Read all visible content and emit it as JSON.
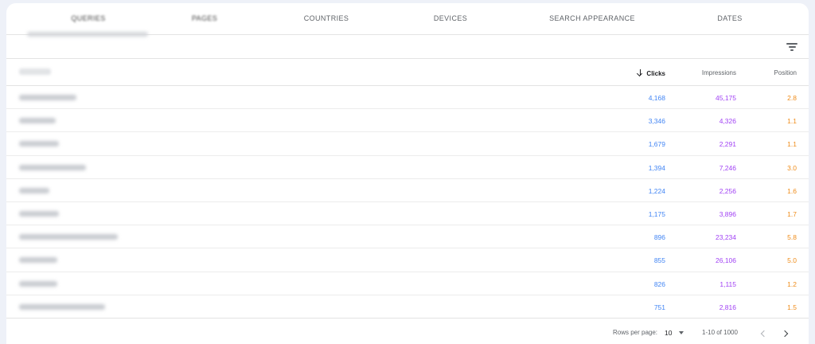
{
  "tabs": [
    {
      "label": "QUERIES",
      "blurred": true
    },
    {
      "label": "PAGES",
      "blurred": true
    },
    {
      "label": "COUNTRIES"
    },
    {
      "label": "DEVICES"
    },
    {
      "label": "SEARCH APPEARANCE"
    },
    {
      "label": "DATES"
    }
  ],
  "icons": {
    "filter": "filter-icon",
    "sort": "arrow-down-icon",
    "prev": "chevron-left-icon",
    "next": "chevron-right-icon",
    "dropdown": "caret-down-icon"
  },
  "colors": {
    "clicks": "#4285f4",
    "impressions": "#a142f4",
    "position": "#ef8c1a"
  },
  "table": {
    "headers": {
      "clicks": "Clicks",
      "impressions": "Impressions",
      "position": "Position"
    },
    "rows": [
      {
        "clicks": "4,168",
        "impressions": "45,175",
        "position": "2.8"
      },
      {
        "clicks": "3,346",
        "impressions": "4,326",
        "position": "1.1"
      },
      {
        "clicks": "1,679",
        "impressions": "2,291",
        "position": "1.1"
      },
      {
        "clicks": "1,394",
        "impressions": "7,246",
        "position": "3.0"
      },
      {
        "clicks": "1,224",
        "impressions": "2,256",
        "position": "1.6"
      },
      {
        "clicks": "1,175",
        "impressions": "3,896",
        "position": "1.7"
      },
      {
        "clicks": "896",
        "impressions": "23,234",
        "position": "5.8"
      },
      {
        "clicks": "855",
        "impressions": "26,106",
        "position": "5.0"
      },
      {
        "clicks": "826",
        "impressions": "1,115",
        "position": "1.2"
      },
      {
        "clicks": "751",
        "impressions": "2,816",
        "position": "1.5"
      }
    ]
  },
  "footer": {
    "rows_per_page_label": "Rows per page:",
    "rows_per_page_value": "10",
    "range": "1-10 of 1000"
  }
}
